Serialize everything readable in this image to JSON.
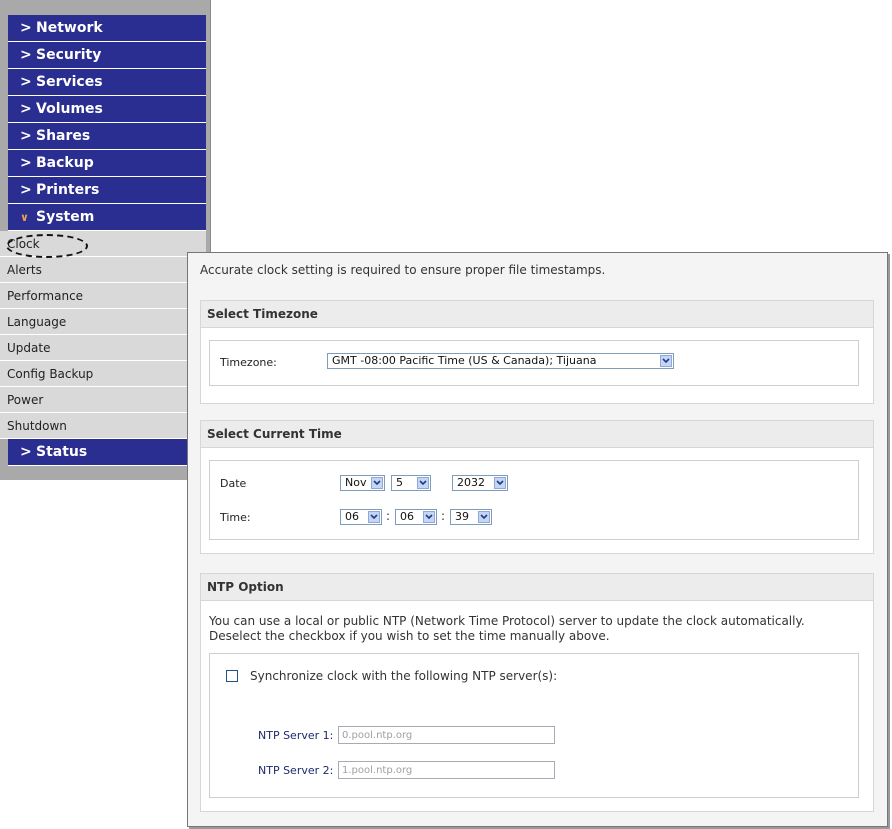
{
  "sidebar": {
    "sections_top": [
      {
        "label": "Network"
      },
      {
        "label": "Security"
      },
      {
        "label": "Services"
      },
      {
        "label": "Volumes"
      },
      {
        "label": "Shares"
      },
      {
        "label": "Backup"
      },
      {
        "label": "Printers"
      }
    ],
    "system": {
      "label": "System",
      "expanded": true
    },
    "system_items": [
      {
        "label": "Clock",
        "selected": true
      },
      {
        "label": "Alerts"
      },
      {
        "label": "Performance"
      },
      {
        "label": "Language"
      },
      {
        "label": "Update"
      },
      {
        "label": "Config Backup"
      },
      {
        "label": "Power"
      },
      {
        "label": "Shutdown"
      }
    ],
    "status": {
      "label": "Status"
    },
    "chevron_closed": ">",
    "chevron_open": "∨"
  },
  "panel": {
    "intro": "Accurate clock setting is required to ensure proper file timestamps.",
    "timezone_section": {
      "title": "Select Timezone",
      "label": "Timezone:",
      "value": "GMT -08:00 Pacific Time (US & Canada); Tijuana"
    },
    "time_section": {
      "title": "Select Current Time",
      "date_label": "Date",
      "month": "Nov",
      "day": "5",
      "year": "2032",
      "time_label": "Time:",
      "hour": "06",
      "minute": "06",
      "second": "39",
      "colon": ":"
    },
    "ntp_section": {
      "title": "NTP Option",
      "description_line1": "You can use a local or public NTP (Network Time Protocol) server to update the clock automatically.",
      "description_line2": "Deselect the checkbox if you wish to set the time manually above.",
      "sync_checked": false,
      "sync_label": "Synchronize clock with the following NTP server(s):",
      "server1_label": "NTP Server 1:",
      "server1_value": "0.pool.ntp.org",
      "server2_label": "NTP Server 2:",
      "server2_value": "1.pool.ntp.org"
    }
  },
  "colors": {
    "nav_bg": "#2a2e90",
    "sub_bg": "#d9d9d9",
    "accent_open_chevron": "#e8a24a"
  }
}
